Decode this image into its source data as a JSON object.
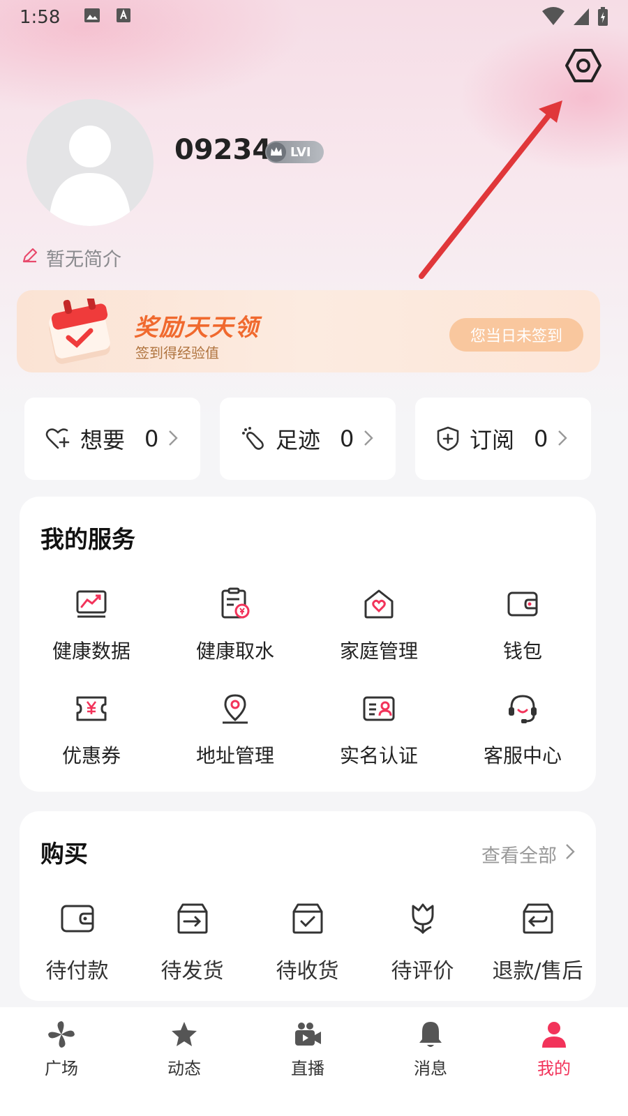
{
  "status_bar": {
    "time": "1:58"
  },
  "profile": {
    "username": "09234",
    "level": "LVI",
    "bio": "暂无简介"
  },
  "reward": {
    "title": "奖励天天领",
    "subtitle": "签到得经验值",
    "signin_label": "您当日未签到"
  },
  "stats": [
    {
      "label": "想要",
      "count": "0",
      "icon": "heart-plus-icon"
    },
    {
      "label": "足迹",
      "count": "0",
      "icon": "footprint-icon"
    },
    {
      "label": "订阅",
      "count": "0",
      "icon": "shield-plus-icon"
    }
  ],
  "services": {
    "title": "我的服务",
    "items": [
      {
        "label": "健康数据",
        "icon": "health-data-icon"
      },
      {
        "label": "健康取水",
        "icon": "water-bill-icon"
      },
      {
        "label": "家庭管理",
        "icon": "family-home-icon"
      },
      {
        "label": "钱包",
        "icon": "wallet-icon"
      },
      {
        "label": "优惠券",
        "icon": "coupon-icon"
      },
      {
        "label": "地址管理",
        "icon": "location-pin-icon"
      },
      {
        "label": "实名认证",
        "icon": "id-card-icon"
      },
      {
        "label": "客服中心",
        "icon": "headset-icon"
      }
    ]
  },
  "purchase": {
    "title": "购买",
    "view_all": "查看全部",
    "items": [
      {
        "label": "待付款",
        "icon": "wallet-icon"
      },
      {
        "label": "待发货",
        "icon": "box-ship-icon"
      },
      {
        "label": "待收货",
        "icon": "box-check-icon"
      },
      {
        "label": "待评价",
        "icon": "flower-review-icon"
      },
      {
        "label": "退款/售后",
        "icon": "box-return-icon"
      }
    ]
  },
  "tabs": [
    {
      "label": "广场",
      "icon": "pinwheel-icon",
      "active": false
    },
    {
      "label": "动态",
      "icon": "star-icon",
      "active": false
    },
    {
      "label": "直播",
      "icon": "video-camera-icon",
      "active": false
    },
    {
      "label": "消息",
      "icon": "bell-icon",
      "active": false
    },
    {
      "label": "我的",
      "icon": "person-icon",
      "active": true
    }
  ],
  "colors": {
    "accent": "#f2335a",
    "reward_orange": "#f0692e",
    "signin_button": "#f9c79e",
    "annotation_arrow": "#e0373a"
  }
}
